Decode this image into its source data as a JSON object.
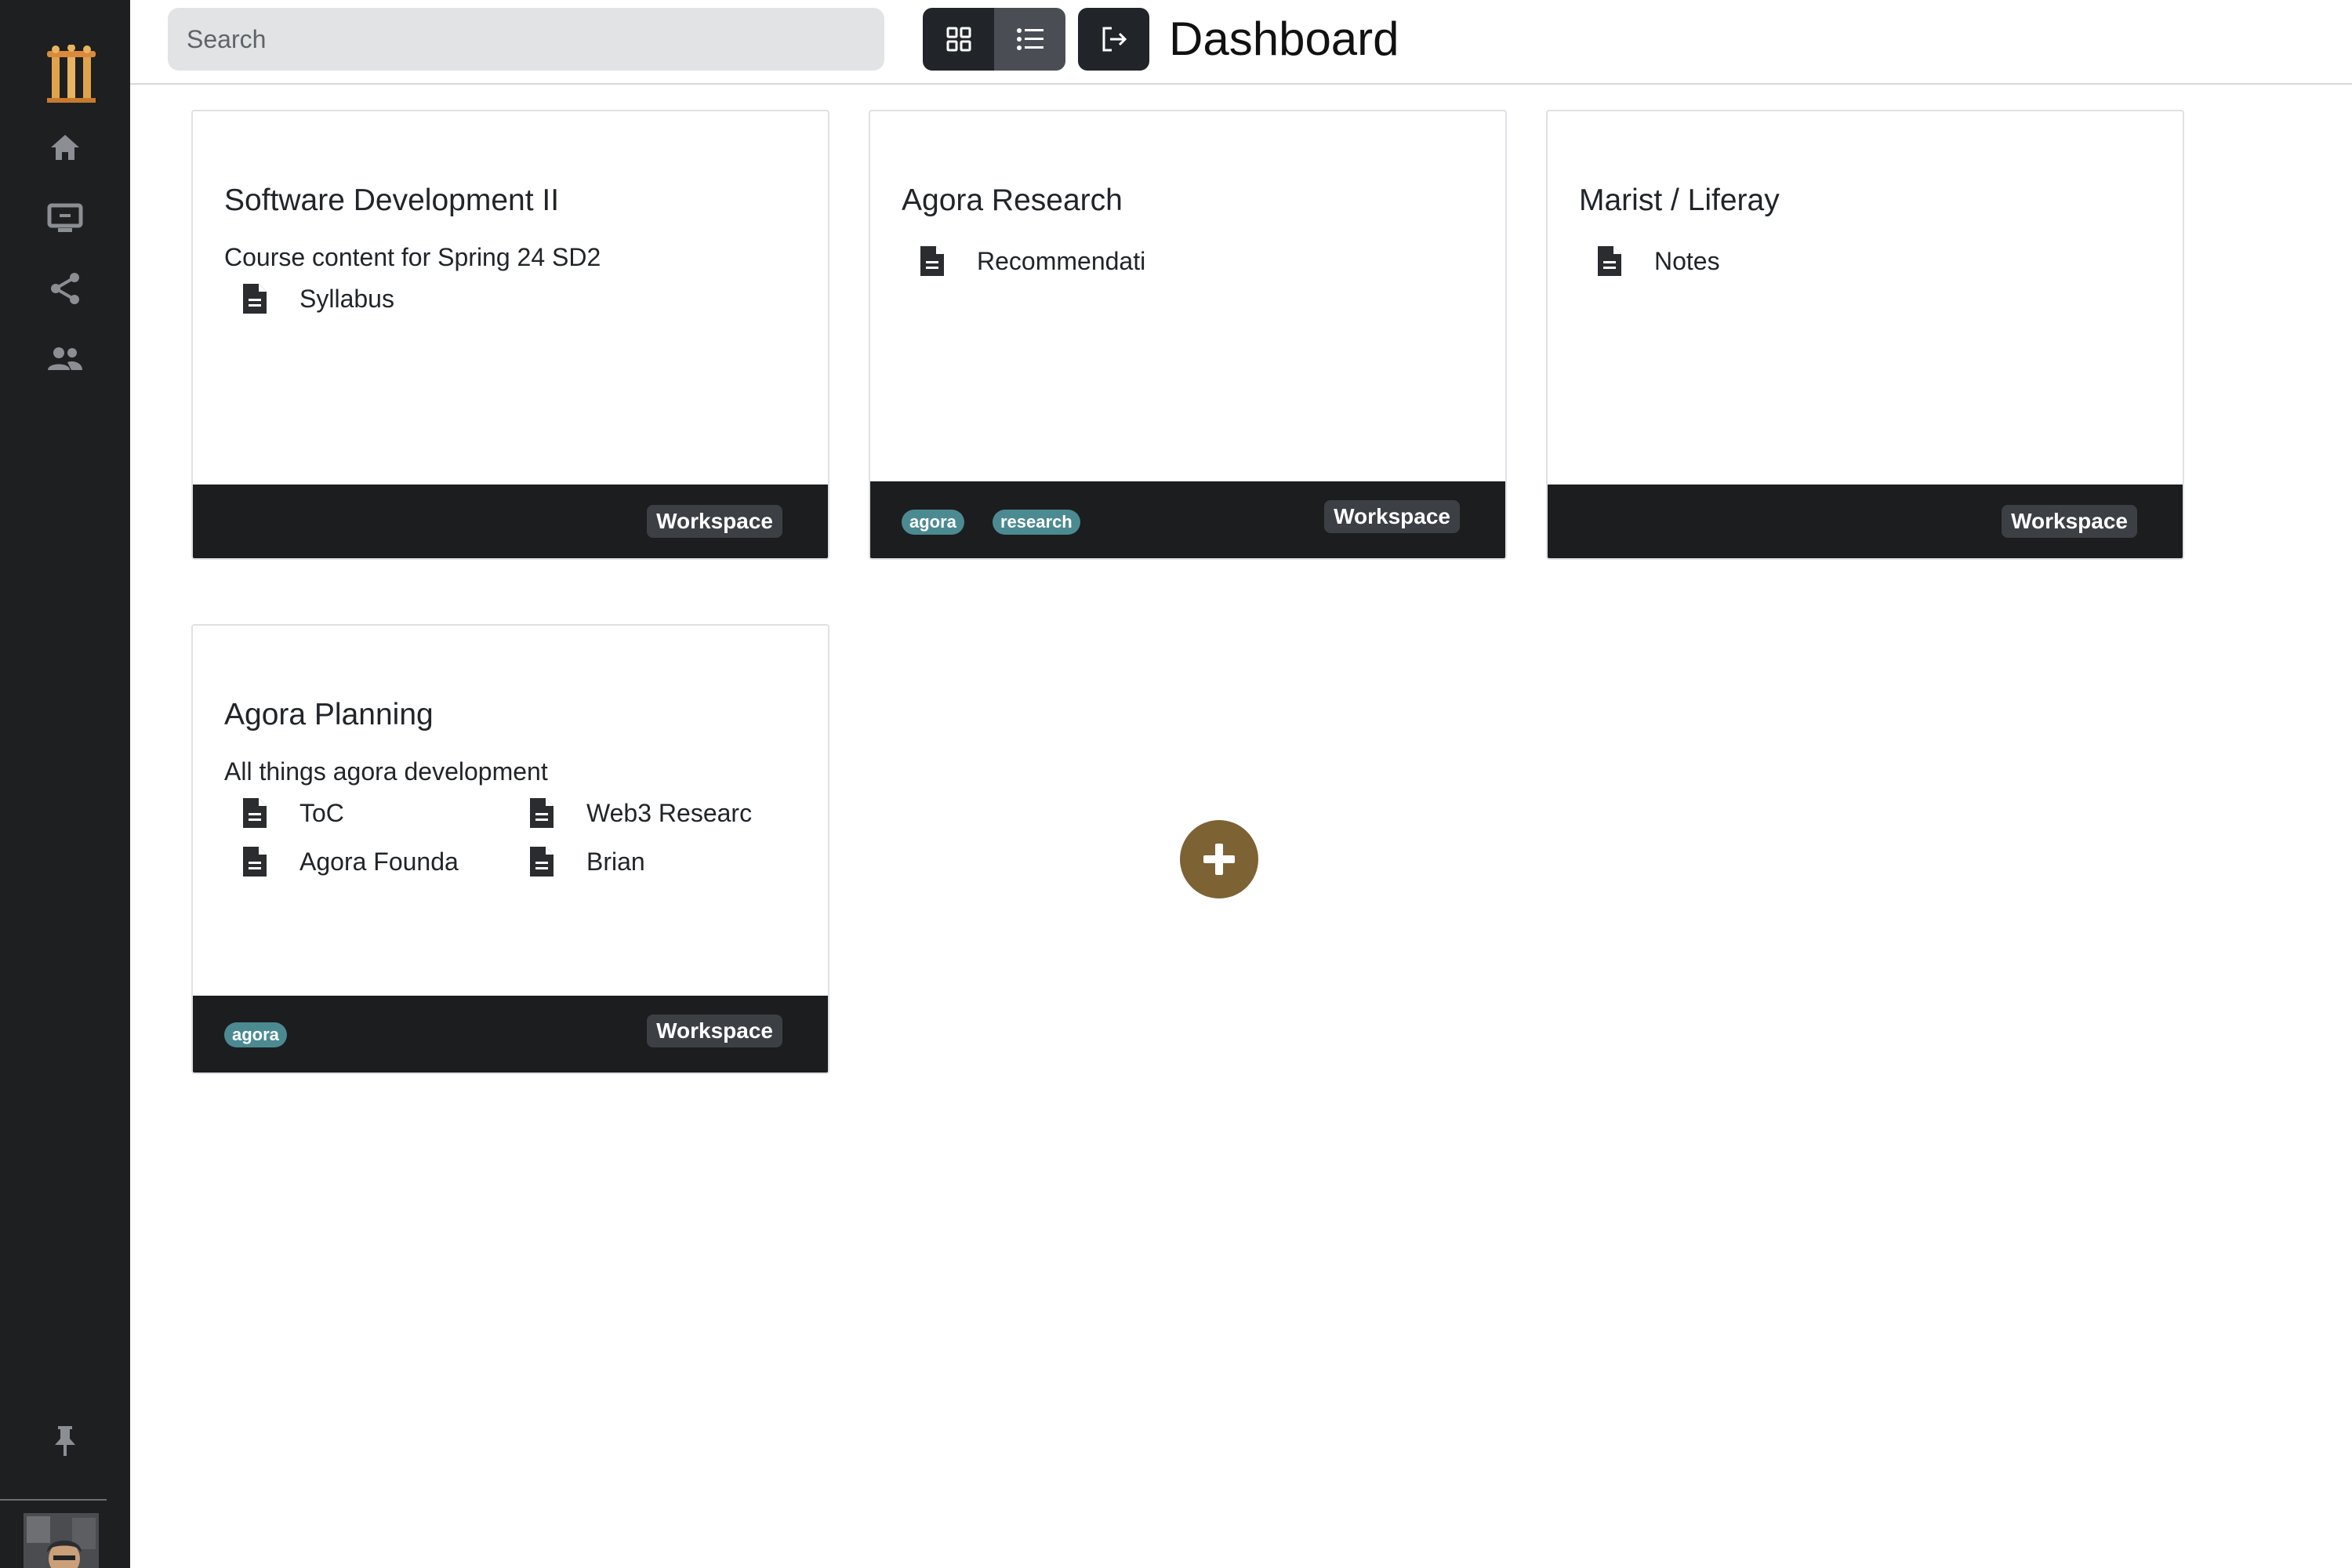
{
  "header": {
    "title": "Dashboard",
    "search_placeholder": "Search"
  },
  "sidebar": {
    "items": [
      {
        "icon": "logo-icon"
      },
      {
        "icon": "home-icon"
      },
      {
        "icon": "monitor-icon"
      },
      {
        "icon": "share-icon"
      },
      {
        "icon": "people-icon"
      }
    ],
    "pin_icon": "pin-icon"
  },
  "cards": [
    {
      "title": "Software Development II",
      "description": "Course content for Spring 24 SD2",
      "docs": [
        "Syllabus"
      ],
      "tags": [],
      "badge": "Workspace"
    },
    {
      "title": "Agora Research",
      "description": "",
      "docs": [
        "Recommendati"
      ],
      "tags": [
        "agora",
        "research"
      ],
      "badge": "Workspace"
    },
    {
      "title": "Marist / Liferay",
      "description": "",
      "docs": [
        "Notes"
      ],
      "tags": [],
      "badge": "Workspace"
    },
    {
      "title": "Agora Planning",
      "description": "All things agora development",
      "docs": [
        "ToC",
        "Web3 Researc",
        "Agora Founda",
        "Brian"
      ],
      "tags": [
        "agora"
      ],
      "badge": "Workspace"
    }
  ],
  "colors": {
    "sidebar_bg": "#1e1f21",
    "footer_bg": "#1c1d1f",
    "tag_bg": "#4c8a92",
    "add_button": "#7d6233"
  }
}
